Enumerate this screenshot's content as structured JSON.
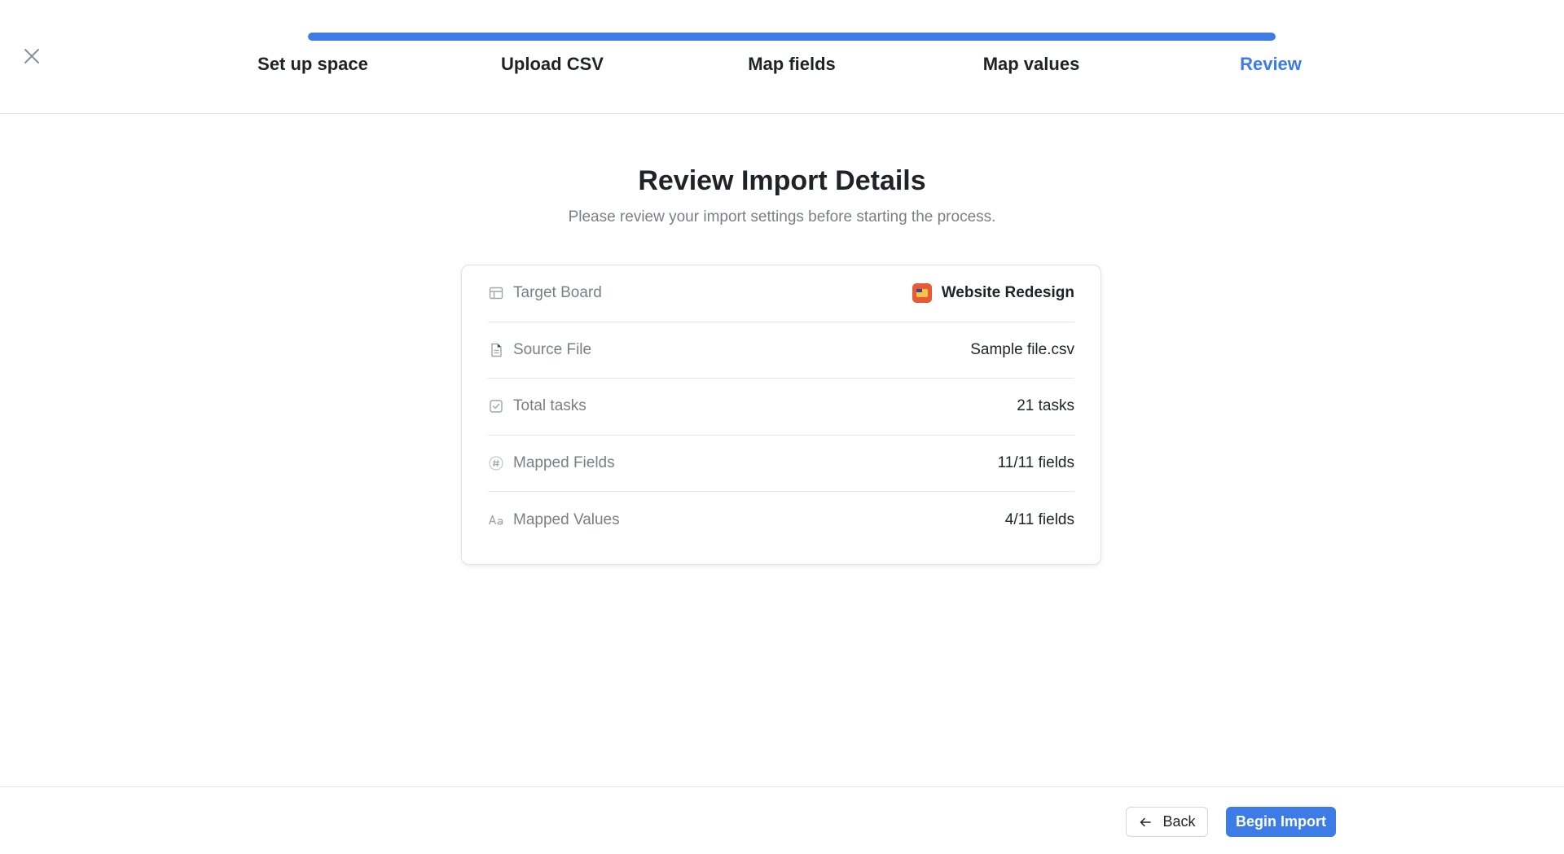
{
  "header": {
    "close_icon": "close-icon",
    "progress": {
      "fraction": 1.0,
      "color": "#3d7be6"
    },
    "steps": [
      {
        "label": "Set up space",
        "active": false
      },
      {
        "label": "Upload CSV",
        "active": false
      },
      {
        "label": "Map fields",
        "active": false
      },
      {
        "label": "Map values",
        "active": false
      },
      {
        "label": "Review",
        "active": true
      }
    ]
  },
  "main": {
    "title": "Review Import Details",
    "subtitle": "Please review your import settings before starting the process.",
    "details": [
      {
        "icon": "board-layout-icon",
        "label": "Target Board",
        "value": "Website Redesign",
        "value_icon": "board-avatar-icon"
      },
      {
        "icon": "file-icon",
        "label": "Source File",
        "value": "Sample file.csv"
      },
      {
        "icon": "checkbox-icon",
        "label": "Total tasks",
        "value": "21 tasks"
      },
      {
        "icon": "hash-icon",
        "label": "Mapped Fields",
        "value": "11/11 fields"
      },
      {
        "icon": "text-format-icon",
        "label": "Mapped Values",
        "value": "4/11 fields"
      }
    ]
  },
  "footer": {
    "back_label": "Back",
    "back_icon": "arrow-left-icon",
    "primary_label": "Begin Import"
  },
  "colors": {
    "accent": "#3d7be6",
    "muted_text": "#7a7f87",
    "border": "#e3e5e8"
  }
}
